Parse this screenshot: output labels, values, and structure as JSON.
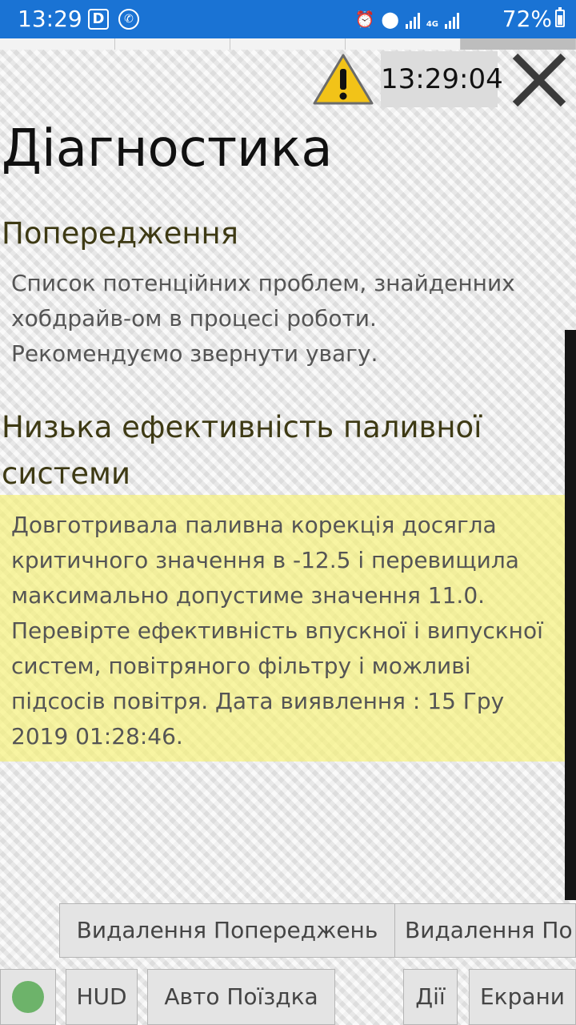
{
  "status_bar": {
    "time": "13:29",
    "app_badge": "D",
    "viber_icon": "viber-icon",
    "network_type": "4G",
    "battery_percent": "72%",
    "battery_level": 0.72
  },
  "header": {
    "clock": "13:29:04",
    "warning_icon": "warning-icon",
    "close_icon": "close-icon"
  },
  "page": {
    "title": "Діагностика"
  },
  "warnings_section": {
    "title": "Попередження",
    "description_lines": [
      "Список потенційних проблем, знайденних",
      "хобдрайв-ом в процесі роботи.",
      "Рекомендуємо звернути увагу."
    ]
  },
  "issue": {
    "title_lines": [
      "Низька ефективність паливної",
      "системи"
    ],
    "details": "Довготривала паливна корекція досягла\nкритичного значення в -12.5 і перевищила\nмаксимально допустиме значення 11.0.\nПеревірте ефективність впускної і випускної\nсистем, повітряного фільтру і можливі\nпідсосів повітря. Дата виявлення : 15 Гру\n2019 01:28:46.",
    "highlight_color": "#f6f278"
  },
  "actions": {
    "delete_warnings": "Видалення Попереджень",
    "delete_partial": "Видалення По"
  },
  "bottom_bar": {
    "status_indicator_color": "#6db36a",
    "hud": "HUD",
    "auto_trip": "Авто Поїздка",
    "actions": "Дії",
    "screens": "Екрани"
  }
}
